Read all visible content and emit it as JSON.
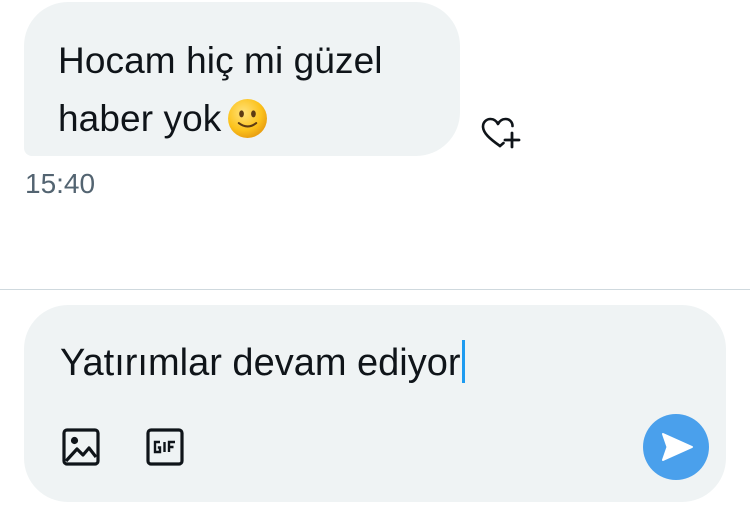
{
  "message": {
    "lines": [
      "Hocam hiç mi güzel",
      "haber yok"
    ],
    "emoji": "slightly-smiling-face",
    "time": "15:40",
    "reaction_icon": "heart-plus-icon"
  },
  "composer": {
    "text": "Yatırımlar devam ediyor",
    "tools": [
      "image-icon",
      "gif-icon"
    ],
    "send_icon": "send-icon"
  },
  "colors": {
    "bubble": "#eff3f4",
    "text": "#0f1419",
    "muted": "#536471",
    "caret": "#1d9bf0",
    "send": "#4aa0ec",
    "divider": "#cfd9de"
  }
}
